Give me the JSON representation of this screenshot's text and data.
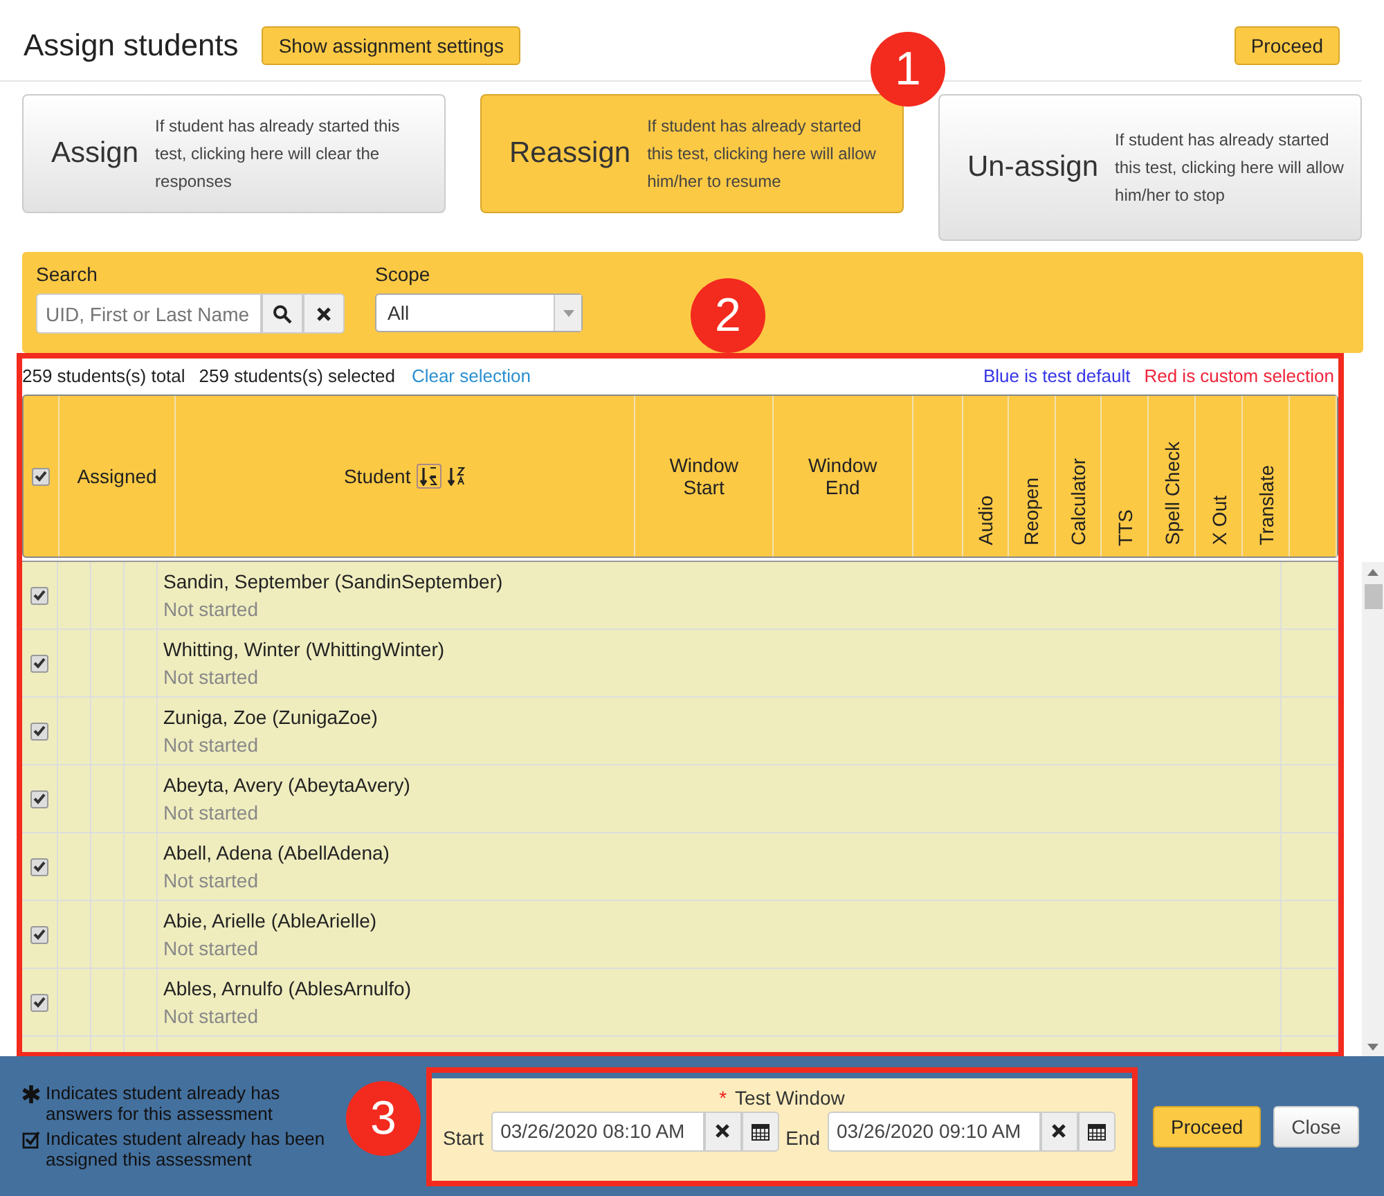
{
  "dialog": {
    "title": "Assign students",
    "settings_button": "Show assignment settings",
    "proceed_button": "Proceed"
  },
  "modes": [
    {
      "title": "Assign",
      "description": "If student has already started this test, clicking here will clear the responses",
      "selected": false
    },
    {
      "title": "Reassign",
      "description": "If student has already started this test, clicking here will allow him/her to resume",
      "selected": true
    },
    {
      "title": "Un-assign",
      "description": "If student has already started this test, clicking here will allow him/her to stop",
      "selected": false
    }
  ],
  "filters": {
    "search_label": "Search",
    "search_placeholder": "UID, First or Last Name",
    "scope_label": "Scope",
    "scope_value": "All"
  },
  "summary": {
    "total": "259 students(s) total",
    "selected": "259 students(s) selected",
    "clear_link": "Clear selection",
    "legend_default": "Blue is test default",
    "legend_custom": "Red is custom selection"
  },
  "table": {
    "select_all_checked": true,
    "columns": [
      {
        "label": "Assigned",
        "kind": "text"
      },
      {
        "label": "Student",
        "kind": "sort"
      },
      {
        "label": "Window Start",
        "kind": "text"
      },
      {
        "label": "Window End",
        "kind": "text"
      },
      {
        "label": "Audio",
        "kind": "vertical"
      },
      {
        "label": "Reopen",
        "kind": "vertical"
      },
      {
        "label": "Calculator",
        "kind": "vertical"
      },
      {
        "label": "TTS",
        "kind": "vertical"
      },
      {
        "label": "Spell Check",
        "kind": "vertical"
      },
      {
        "label": "X Out",
        "kind": "vertical"
      },
      {
        "label": "Translate",
        "kind": "vertical"
      }
    ],
    "rows": [
      {
        "name": "Sandin, September (SandinSeptember)",
        "status": "Not started",
        "checked": true
      },
      {
        "name": "Whitting, Winter (WhittingWinter)",
        "status": "Not started",
        "checked": true
      },
      {
        "name": "Zuniga, Zoe (ZunigaZoe)",
        "status": "Not started",
        "checked": true
      },
      {
        "name": "Abeyta, Avery (AbeytaAvery)",
        "status": "Not started",
        "checked": true
      },
      {
        "name": "Abell, Adena (AbellAdena)",
        "status": "Not started",
        "checked": true
      },
      {
        "name": "Abie, Arielle (AbleArielle)",
        "status": "Not started",
        "checked": true
      },
      {
        "name": "Ables, Arnulfo (AblesArnulfo)",
        "status": "Not started",
        "checked": true
      }
    ]
  },
  "footer": {
    "legend": [
      {
        "kind": "answers",
        "text": "Indicates student already has answers for this assessment"
      },
      {
        "kind": "assigned",
        "text": "Indicates student already has been assigned this assessment"
      }
    ],
    "test_window": {
      "required_mark": "*",
      "label": "Test Window",
      "start_label": "Start",
      "start_value": "03/26/2020 08:10 AM",
      "end_label": "End",
      "end_value": "03/26/2020 09:10 AM"
    },
    "buttons": [
      {
        "label": "Proceed",
        "kind": "primary"
      },
      {
        "label": "Close",
        "kind": "default"
      }
    ]
  },
  "callouts": [
    "1",
    "2",
    "3"
  ]
}
